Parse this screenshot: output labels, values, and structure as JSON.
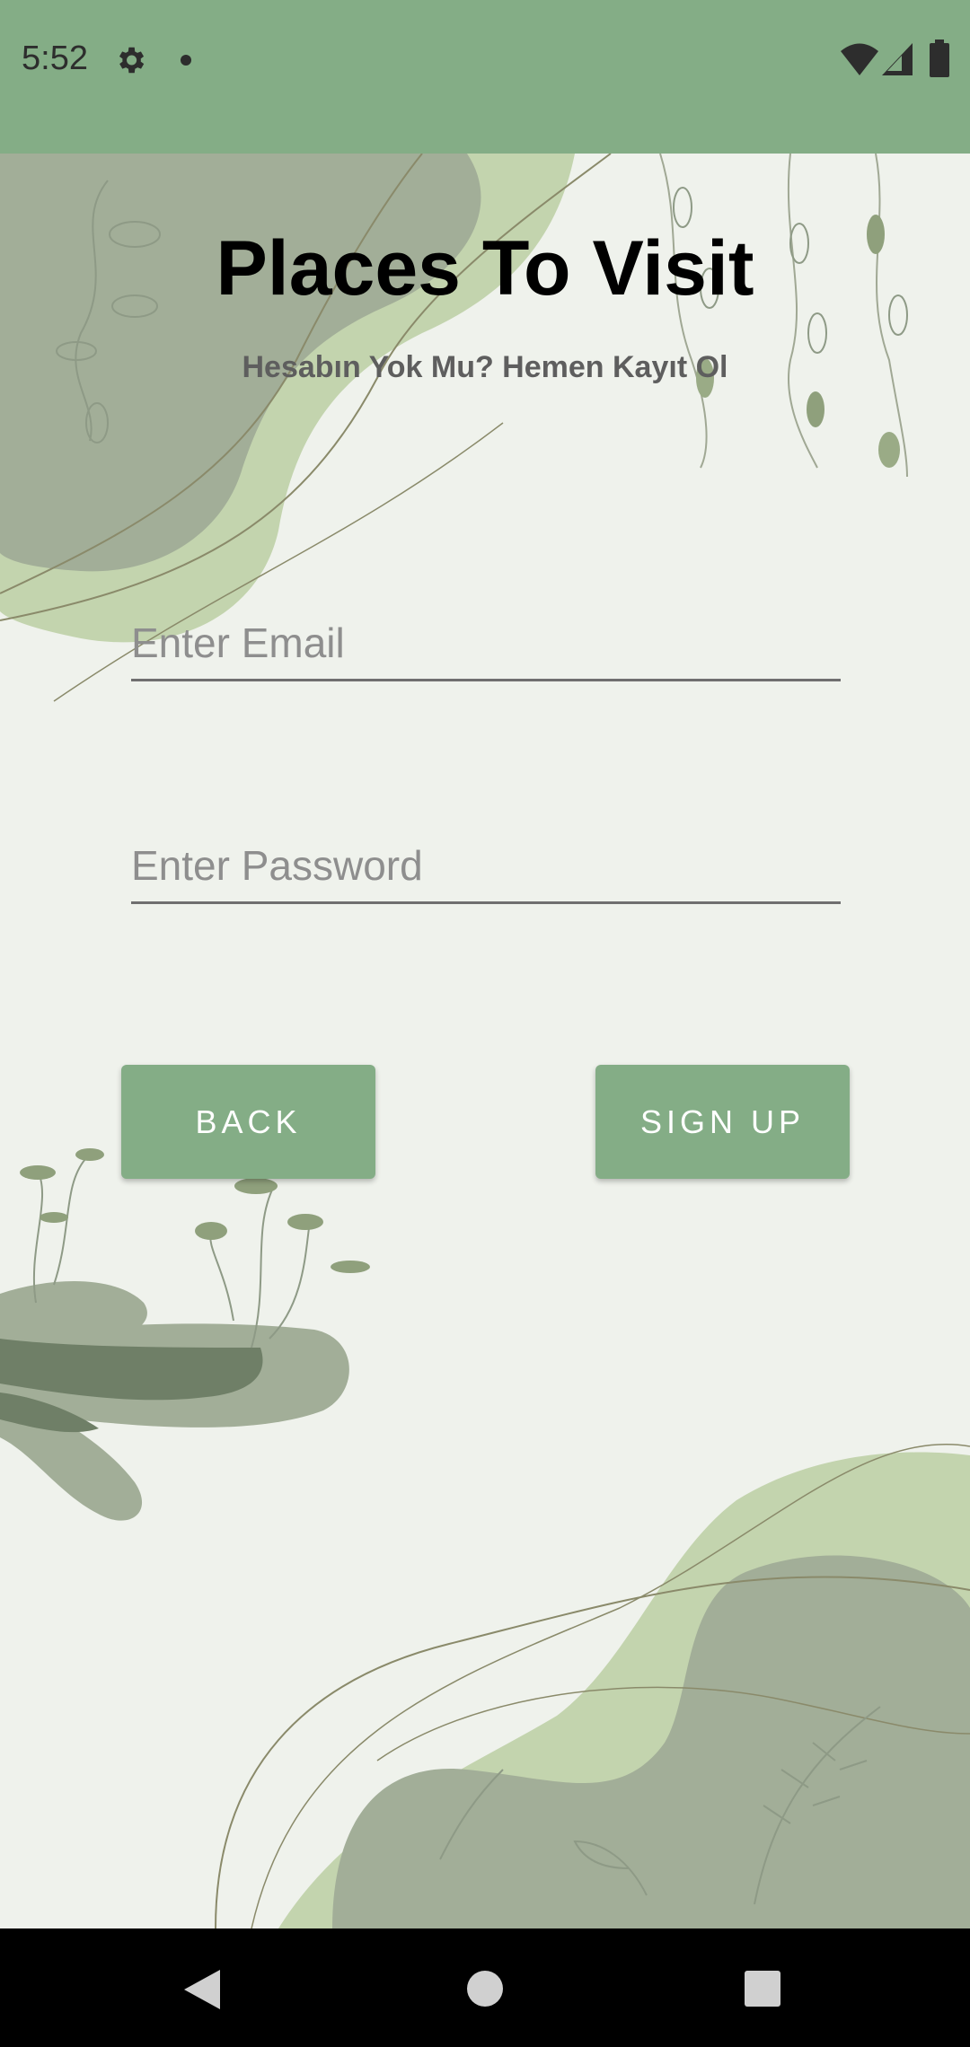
{
  "status_bar": {
    "time": "5:52",
    "background": "#84ad86",
    "icons": [
      "gear-icon",
      "notification-dot-icon",
      "wifi-icon",
      "signal-icon",
      "battery-icon"
    ]
  },
  "app": {
    "title": "Places To Visit",
    "subtitle": "Hesabın Yok Mu? Hemen Kayıt Ol",
    "accent": "#84ad86"
  },
  "form": {
    "email_placeholder": "Enter Email",
    "email_value": "",
    "password_placeholder": "Enter Password",
    "password_value": ""
  },
  "buttons": {
    "back_label": "BACK",
    "signup_label": "SIGN UP"
  },
  "nav_bar": {
    "icons": [
      "back-triangle-icon",
      "home-circle-icon",
      "recents-square-icon"
    ]
  }
}
